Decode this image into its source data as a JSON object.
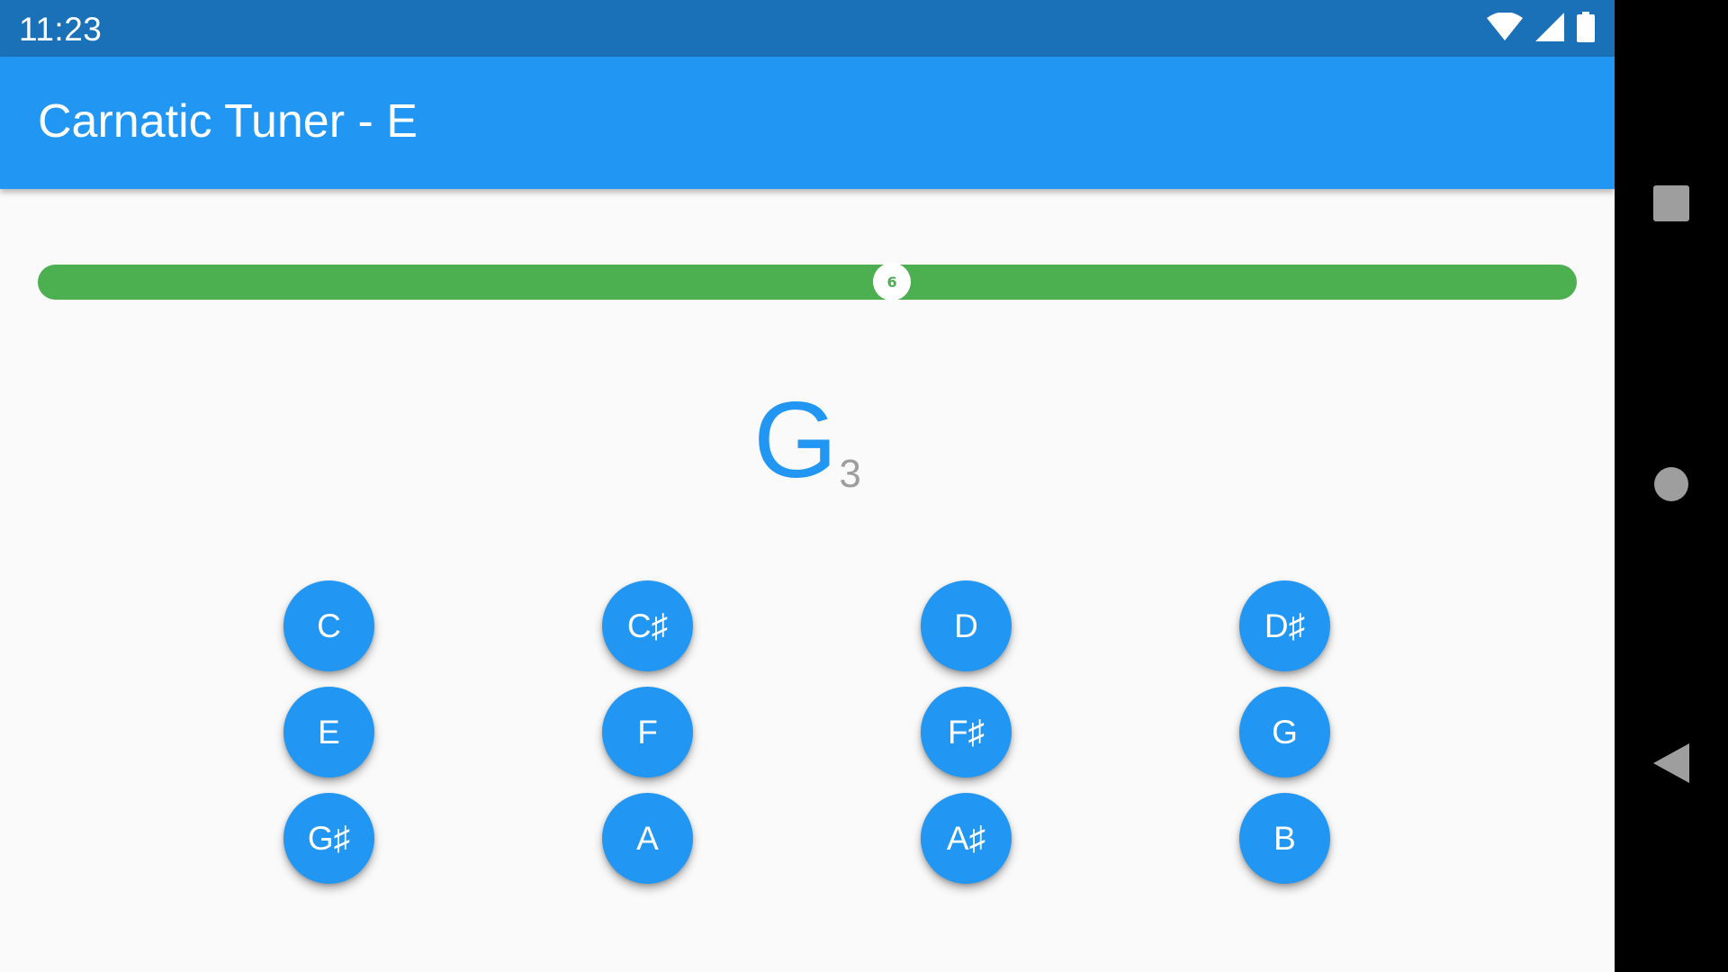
{
  "status_bar": {
    "time": "11:23",
    "icons": [
      "wifi-icon",
      "cell-signal-icon",
      "battery-icon"
    ]
  },
  "app_bar": {
    "title": "Carnatic Tuner - E"
  },
  "tuner": {
    "thumb_label": "6",
    "position_fraction": 0.555,
    "color": "#4caf50"
  },
  "detected_note": {
    "name": "G",
    "octave": "3"
  },
  "note_buttons": [
    {
      "label": "C"
    },
    {
      "label": "C♯"
    },
    {
      "label": "D"
    },
    {
      "label": "D♯"
    },
    {
      "label": "E"
    },
    {
      "label": "F"
    },
    {
      "label": "F♯"
    },
    {
      "label": "G"
    },
    {
      "label": "G♯"
    },
    {
      "label": "A"
    },
    {
      "label": "A♯"
    },
    {
      "label": "B"
    }
  ],
  "navigation": {
    "buttons": [
      "recents-icon",
      "home-icon",
      "back-icon"
    ]
  },
  "colors": {
    "primary": "#2196f3",
    "status_bar": "#1a71b8",
    "tuner_bar": "#4caf50",
    "octave_text": "#9e9e9e"
  }
}
